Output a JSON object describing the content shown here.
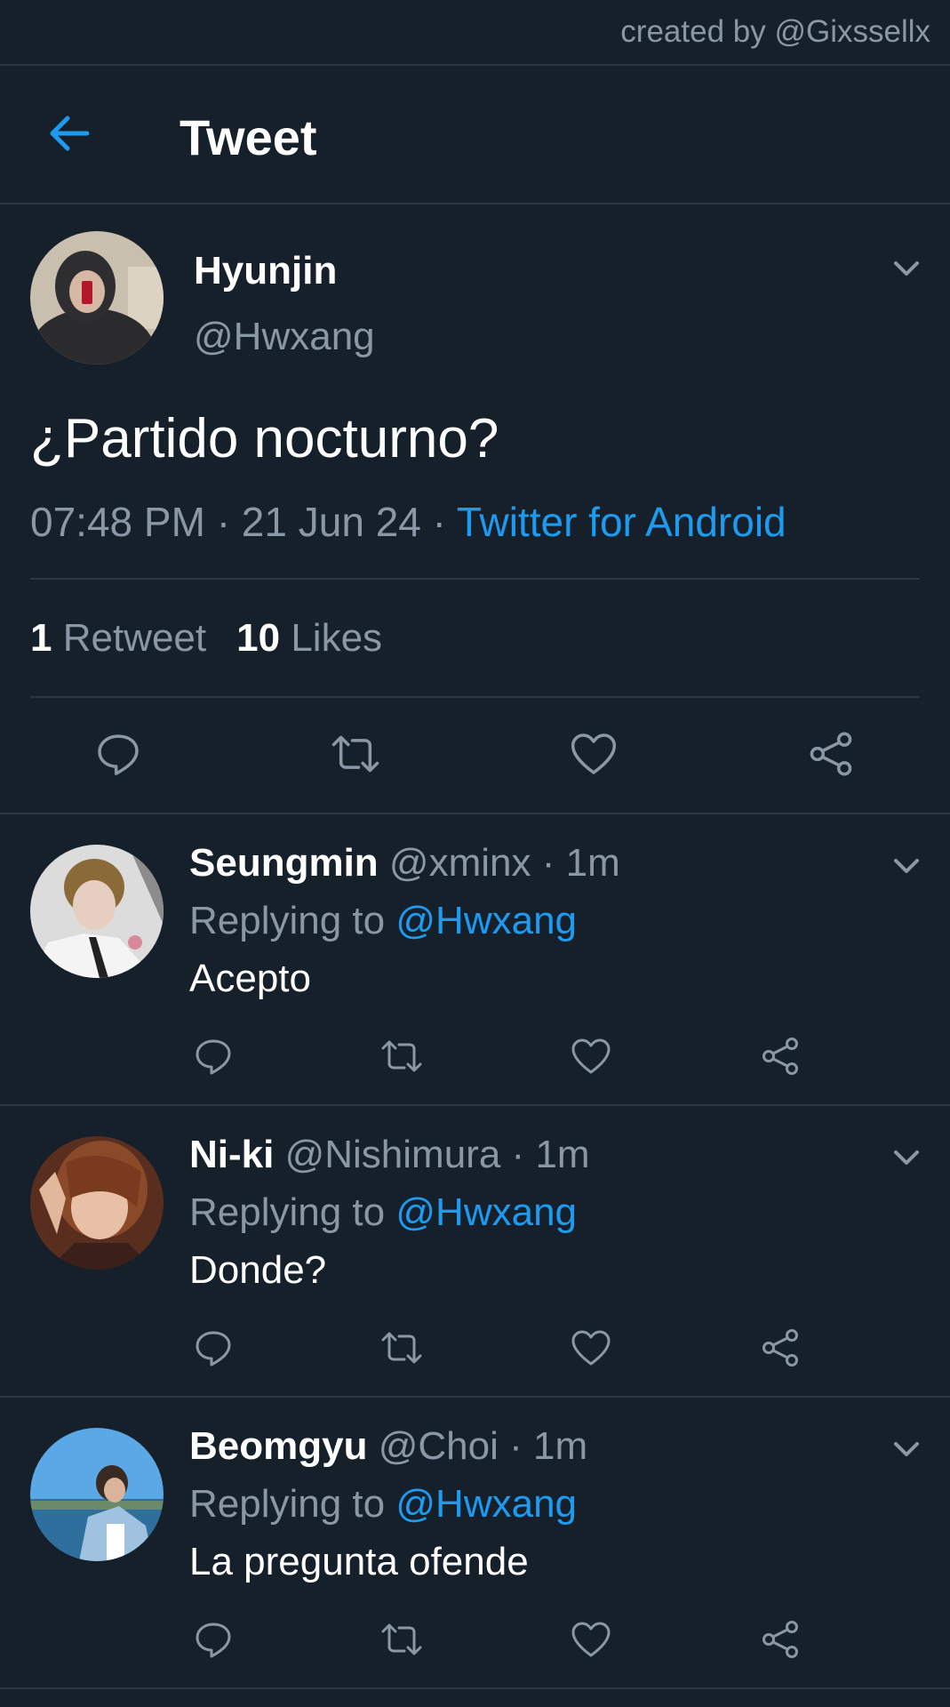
{
  "credit": "created by @Gixssellx",
  "header": {
    "title": "Tweet",
    "back_icon": "back-arrow-icon"
  },
  "colors": {
    "background": "#16202b",
    "accent": "#1d9bf0",
    "muted": "#8a97a5",
    "divider": "#2a3643"
  },
  "tweet": {
    "name": "Hyunjin",
    "handle": "@Hwxang",
    "text": "¿Partido nocturno?",
    "time": "07:48 PM",
    "date": "21 Jun 24",
    "source": "Twitter for Android",
    "retweets_count": "1",
    "retweets_label": "Retweet",
    "likes_count": "10",
    "likes_label": "Likes"
  },
  "replies": [
    {
      "name": "Seungmin",
      "handle": "@xminx",
      "age": "1m",
      "replying_label": "Replying to",
      "replying_to": "@Hwxang",
      "text": "Acepto"
    },
    {
      "name": "Ni-ki",
      "handle": "@Nishimura",
      "age": "1m",
      "replying_label": "Replying to",
      "replying_to": "@Hwxang",
      "text": "Donde?"
    },
    {
      "name": "Beomgyu",
      "handle": "@Choi",
      "age": "1m",
      "replying_label": "Replying to",
      "replying_to": "@Hwxang",
      "text": "La pregunta ofende"
    }
  ],
  "separator": "·"
}
